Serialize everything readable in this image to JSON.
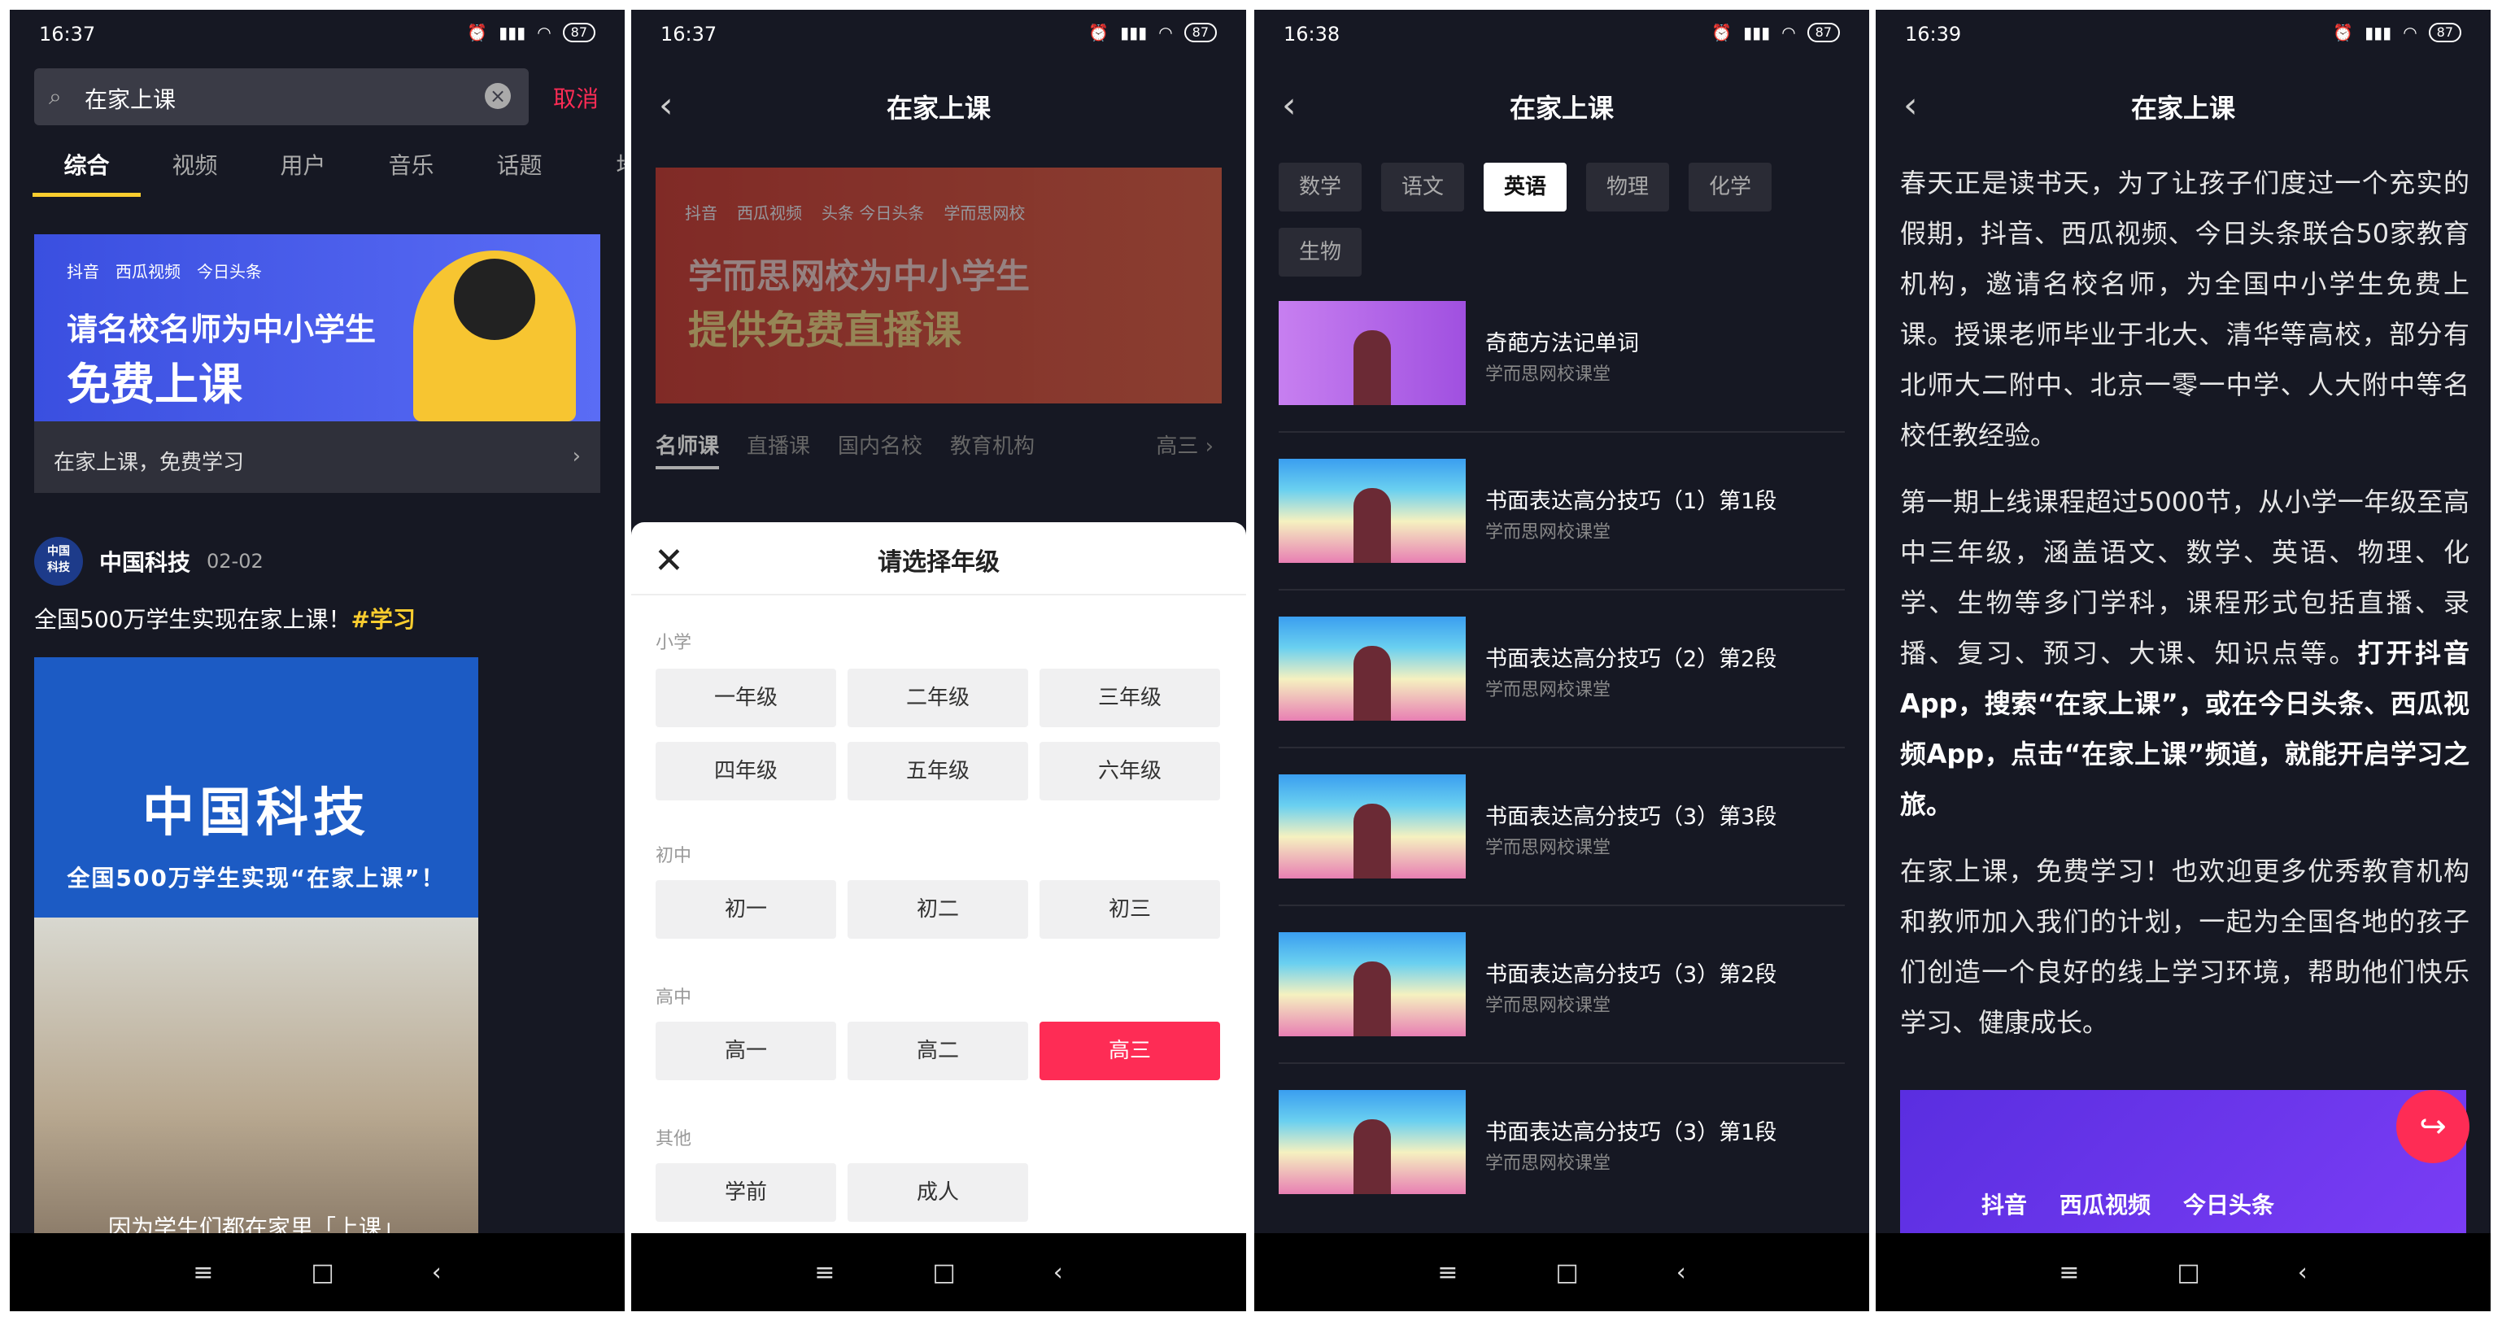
{
  "status": {
    "p1": "16:37",
    "p2": "16:37",
    "p3": "16:38",
    "p4": "16:39",
    "battery": "87"
  },
  "phone1": {
    "search_value": "在家上课",
    "cancel": "取消",
    "tabs": [
      "综合",
      "视频",
      "用户",
      "音乐",
      "话题",
      "地"
    ],
    "banner_logos": [
      "抖音",
      "西瓜视频",
      "今日头条"
    ],
    "banner_line1": "请名校名师为中小学生",
    "banner_line2": "免费上课",
    "banner_sub": "在家上课，免费学习",
    "author": "中国科技",
    "date": "02-02",
    "post_text": "全国500万学生实现在家上课！",
    "post_tag": "#学习",
    "video_title": "中国科技",
    "video_subtitle": "全国500万学生实现“在家上课”！",
    "video_caption": "因为学生们都在家里「上课」"
  },
  "phone2": {
    "title": "在家上课",
    "banner_logos": [
      "抖音",
      "西瓜视频",
      "头条 今日头条",
      "学而思网校"
    ],
    "banner_line1": "学而思网校为中小学生",
    "banner_line2": "提供免费直播课",
    "tabs": [
      "名师课",
      "直播课",
      "国内名校",
      "教育机构"
    ],
    "tab_right": "高三",
    "sheet_title": "请选择年级",
    "groups": [
      {
        "label": "小学",
        "grades": [
          "一年级",
          "二年级",
          "三年级",
          "四年级",
          "五年级",
          "六年级"
        ]
      },
      {
        "label": "初中",
        "grades": [
          "初一",
          "初二",
          "初三"
        ]
      },
      {
        "label": "高中",
        "grades": [
          "高一",
          "高二",
          "高三"
        ]
      },
      {
        "label": "其他",
        "grades": [
          "学前",
          "成人"
        ]
      }
    ],
    "selected_grade": "高三"
  },
  "phone3": {
    "title": "在家上课",
    "subjects": [
      "数学",
      "语文",
      "英语",
      "物理",
      "化学",
      "生物"
    ],
    "active_subject": "英语",
    "courses": [
      {
        "title": "奇葩方法记单词",
        "source": "学而思网校课堂"
      },
      {
        "title": "书面表达高分技巧（1）第1段",
        "source": "学而思网校课堂"
      },
      {
        "title": "书面表达高分技巧（2）第2段",
        "source": "学而思网校课堂"
      },
      {
        "title": "书面表达高分技巧（3）第3段",
        "source": "学而思网校课堂"
      },
      {
        "title": "书面表达高分技巧（3）第2段",
        "source": "学而思网校课堂"
      },
      {
        "title": "书面表达高分技巧（3）第1段",
        "source": "学而思网校课堂"
      }
    ]
  },
  "phone4": {
    "title": "在家上课",
    "para1": "春天正是读书天，为了让孩子们度过一个充实的假期，抖音、西瓜视频、今日头条联合50家教育机构，邀请名校名师，为全国中小学生免费上课。授课老师毕业于北大、清华等高校，部分有北师大二附中、北京一零一中学、人大附中等名校任教经验。",
    "para2a": "第一期上线课程超过5000节，从小学一年级至高中三年级，涵盖语文、数学、英语、物理、化学、生物等多门学科，课程形式包括直播、录播、复习、预习、大课、知识点等。",
    "para2b": "打开抖音App，搜索“在家上课”，或在今日头条、西瓜视频App，点击“在家上课”频道，就能开启学习之旅。",
    "para3": "在家上课，免费学习！也欢迎更多优秀教育机构和教师加入我们的计划，一起为全国各地的孩子们创造一个良好的线上学习环境，帮助他们快乐学习、健康成长。",
    "banner_logos": [
      "抖音",
      "西瓜视频",
      "今日头条"
    ]
  },
  "nav": {
    "menu": "≡",
    "home": "□",
    "back": "‹"
  }
}
